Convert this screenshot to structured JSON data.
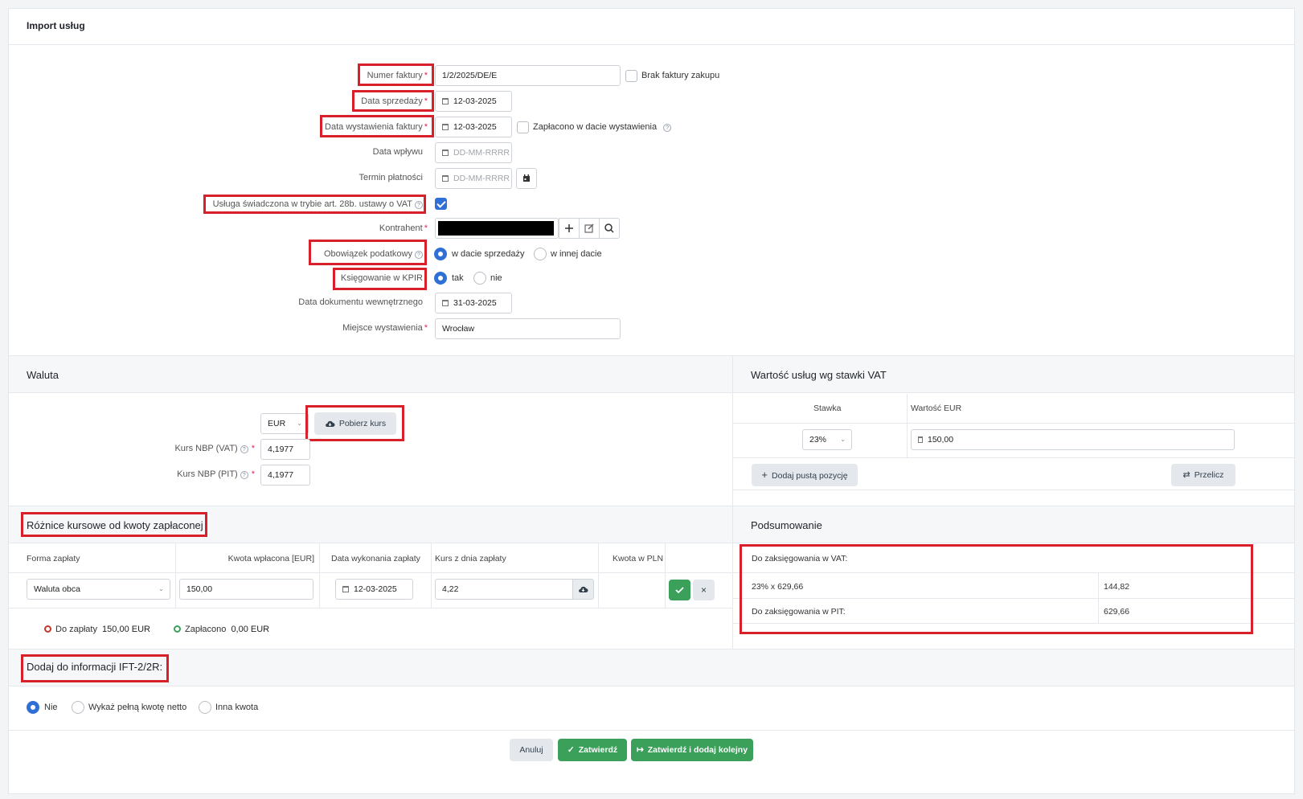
{
  "header": {
    "title": "Import usług"
  },
  "form": {
    "invoice_number": {
      "label": "Numer faktury",
      "value": "1/2/2025/DE/E"
    },
    "no_invoice_checkbox_label": "Brak faktury zakupu",
    "sale_date": {
      "label": "Data sprzedaży",
      "value": "12-03-2025"
    },
    "issue_date": {
      "label": "Data wystawienia faktury",
      "value": "12-03-2025"
    },
    "paid_on_issue_label": "Zapłacono w dacie wystawienia",
    "receipt_date": {
      "label": "Data wpływu",
      "placeholder": "DD-MM-RRRR"
    },
    "payment_term": {
      "label": "Termin płatności",
      "placeholder": "DD-MM-RRRR"
    },
    "art28b": {
      "label": "Usługa świadczona w trybie art. 28b. ustawy o VAT",
      "checked": true
    },
    "contractor": {
      "label": "Kontrahent"
    },
    "tax_obligation": {
      "label": "Obowiązek podatkowy",
      "option1": "w dacie sprzedaży",
      "option2": "w innej dacie"
    },
    "kpir": {
      "label": "Księgowanie w KPIR",
      "option1": "tak",
      "option2": "nie"
    },
    "internal_doc_date": {
      "label": "Data dokumentu wewnętrznego",
      "value": "31-03-2025"
    },
    "issue_place": {
      "label": "Miejsce wystawienia",
      "value": "Wrocław"
    },
    "required_mark": "*",
    "help_mark": "?"
  },
  "currency": {
    "title": "Waluta",
    "selected": "EUR",
    "fetch_rate_label": "Pobierz kurs",
    "nbp_vat": {
      "label": "Kurs NBP (VAT)",
      "value": "4,1977"
    },
    "nbp_pit": {
      "label": "Kurs NBP (PIT)",
      "value": "4,1977"
    }
  },
  "vat_values": {
    "title": "Wartość usług wg stawki VAT",
    "col_rate": "Stawka",
    "col_value": "Wartość EUR",
    "rate": "23%",
    "value": "150,00",
    "add_empty_label": "Dodaj pustą pozycję",
    "recalc_label": "Przelicz"
  },
  "fx_diff": {
    "title": "Różnice kursowe od kwoty zapłaconej",
    "columns": [
      "Forma zapłaty",
      "Kwota wpłacona [EUR]",
      "Data wykonania zapłaty",
      "Kurs z dnia zapłaty",
      "Kwota w PLN"
    ],
    "payment_form": "Waluta obca",
    "amount_paid": "150,00",
    "payment_date": "12-03-2025",
    "rate": "4,22",
    "to_pay_label": "Do zapłaty",
    "to_pay_value": "150,00 EUR",
    "paid_label": "Zapłacono",
    "paid_value": "0,00 EUR"
  },
  "summary": {
    "title": "Podsumowanie",
    "vat_header": "Do zaksięgowania w VAT:",
    "vat_row_label": "23% x 629,66",
    "vat_row_value": "144,82",
    "pit_label": "Do zaksięgowania w PIT:",
    "pit_value": "629,66"
  },
  "ift": {
    "title": "Dodaj do informacji IFT-2/2R:",
    "option1": "Nie",
    "option2": "Wykaż pełną kwotę netto",
    "option3": "Inna kwota"
  },
  "footer": {
    "cancel_label": "Anuluj",
    "confirm_label": "Zatwierdź",
    "confirm_add_label": "Zatwierdź i dodaj kolejny"
  },
  "colors": {
    "accent": "#2f6fd6",
    "success": "#3aa05a",
    "highlight": "#d8202a"
  }
}
